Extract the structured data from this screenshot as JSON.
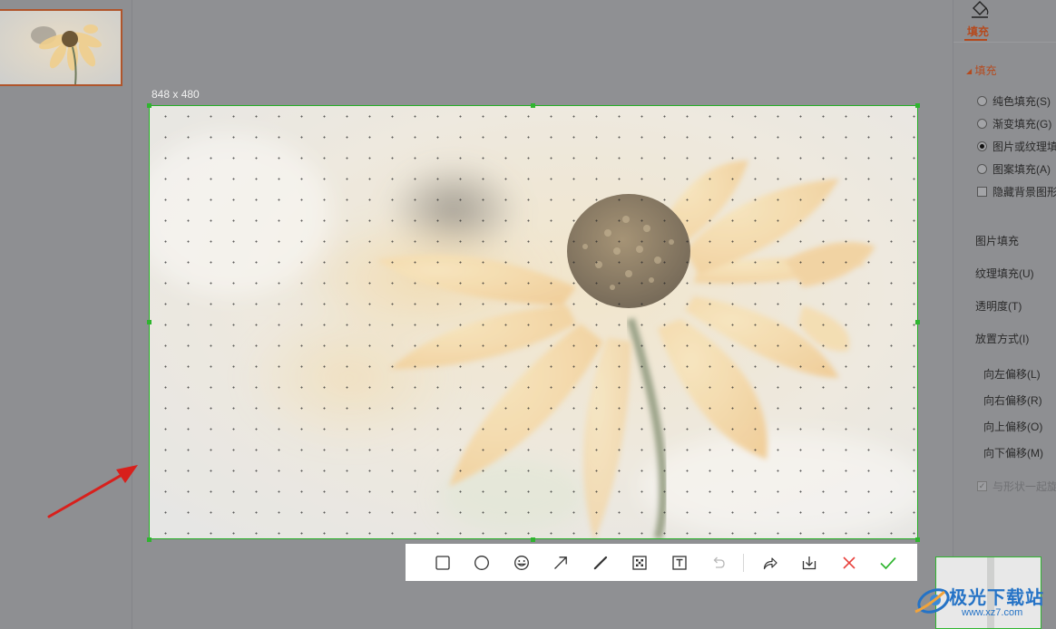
{
  "canvas": {
    "size_label": "848 x 480"
  },
  "toolbar": {
    "tools": [
      {
        "name": "rectangle-tool",
        "icon": "square-icon"
      },
      {
        "name": "ellipse-tool",
        "icon": "circle-icon"
      },
      {
        "name": "emoji-tool",
        "icon": "smiley-icon"
      },
      {
        "name": "arrow-tool",
        "icon": "arrow-icon"
      },
      {
        "name": "pen-tool",
        "icon": "pen-icon"
      },
      {
        "name": "mosaic-tool",
        "icon": "mosaic-icon"
      },
      {
        "name": "text-tool",
        "icon": "text-icon"
      },
      {
        "name": "undo-button",
        "icon": "undo-icon"
      },
      {
        "name": "share-button",
        "icon": "share-icon"
      },
      {
        "name": "save-button",
        "icon": "download-icon"
      },
      {
        "name": "cancel-button",
        "icon": "close-icon",
        "color": "#e8413c"
      },
      {
        "name": "confirm-button",
        "icon": "check-icon",
        "color": "#2fb52f"
      }
    ]
  },
  "right_panel": {
    "tab_label": "填充",
    "section_title": "填充",
    "fill_options": [
      {
        "label": "纯色填充(S)",
        "type": "radio",
        "checked": false
      },
      {
        "label": "渐变填充(G)",
        "type": "radio",
        "checked": false
      },
      {
        "label": "图片或纹理填",
        "type": "radio",
        "checked": true
      },
      {
        "label": "图案填充(A)",
        "type": "radio",
        "checked": false
      },
      {
        "label": "隐藏背景图形",
        "type": "checkbox",
        "checked": false
      }
    ],
    "properties": [
      "图片填充",
      "纹理填充(U)",
      "透明度(T)",
      "放置方式(I)"
    ],
    "offsets": [
      "向左偏移(L)",
      "向右偏移(R)",
      "向上偏移(O)",
      "向下偏移(M)"
    ],
    "rotate_with_shape": "与形状一起旋"
  },
  "watermark": {
    "brand": "极光下载站",
    "url": "www.xz7.com"
  },
  "colors": {
    "accent": "#b54a1e",
    "selection": "#2fb52f",
    "annotation_arrow": "#d8201c"
  }
}
